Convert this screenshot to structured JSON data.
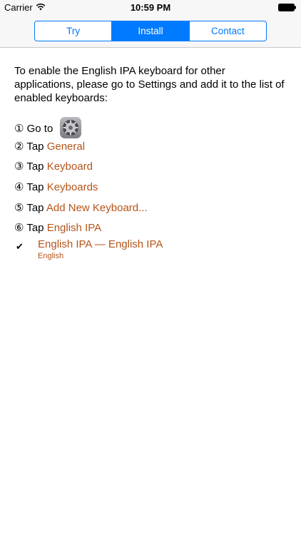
{
  "status_bar": {
    "carrier": "Carrier",
    "time": "10:59 PM",
    "icons": [
      "wifi-icon",
      "battery-icon"
    ]
  },
  "segmented_control": {
    "segments": [
      {
        "label": "Try",
        "selected": false
      },
      {
        "label": "Install",
        "selected": true
      },
      {
        "label": "Contact",
        "selected": false
      }
    ]
  },
  "content": {
    "intro": "To enable the English IPA keyboard for other applications, please go to Settings and add it to the list of enabled keyboards:",
    "steps": [
      {
        "prefix": "① Go to",
        "link": "",
        "icon": "settings-gear-icon"
      },
      {
        "prefix": "② Tap",
        "link": "General"
      },
      {
        "prefix": "③ Tap",
        "link": "Keyboard"
      },
      {
        "prefix": "④ Tap",
        "link": "Keyboards"
      },
      {
        "prefix": "⑤ Tap",
        "link": "Add New Keyboard..."
      },
      {
        "prefix": "⑥ Tap",
        "link": "English IPA"
      }
    ],
    "checked_keyboard": {
      "checkmark": "✔",
      "name": "English IPA — English IPA",
      "language": "English"
    }
  },
  "colors": {
    "accent": "#007aff",
    "link": "#b5541a",
    "bar_background": "#f7f7f7"
  }
}
